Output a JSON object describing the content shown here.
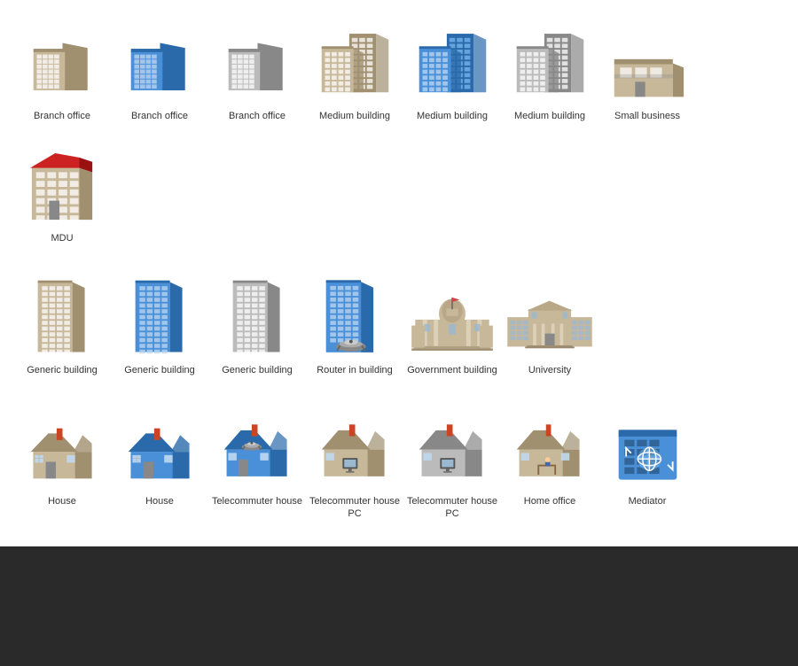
{
  "icons": [
    {
      "id": "branch-office-beige",
      "label": "Branch office",
      "type": "branch-beige"
    },
    {
      "id": "branch-office-blue",
      "label": "Branch office",
      "type": "branch-blue"
    },
    {
      "id": "branch-office-gray",
      "label": "Branch office",
      "type": "branch-gray"
    },
    {
      "id": "medium-building-beige",
      "label": "Medium building",
      "type": "medium-beige"
    },
    {
      "id": "medium-building-blue",
      "label": "Medium building",
      "type": "medium-blue"
    },
    {
      "id": "medium-building-gray",
      "label": "Medium building",
      "type": "medium-gray"
    },
    {
      "id": "small-business",
      "label": "Small business",
      "type": "small-business"
    },
    {
      "id": "mdu",
      "label": "MDU",
      "type": "mdu"
    },
    {
      "id": "generic-building-beige",
      "label": "Generic building",
      "type": "generic-beige"
    },
    {
      "id": "generic-building-blue",
      "label": "Generic building",
      "type": "generic-blue"
    },
    {
      "id": "generic-building-gray",
      "label": "Generic building",
      "type": "generic-gray"
    },
    {
      "id": "router-in-building",
      "label": "Router in building",
      "type": "router-building"
    },
    {
      "id": "government-building",
      "label": "Government building",
      "type": "government"
    },
    {
      "id": "university",
      "label": "University",
      "type": "university"
    },
    {
      "id": "house-beige",
      "label": "House",
      "type": "house-beige"
    },
    {
      "id": "house-blue",
      "label": "House",
      "type": "house-blue"
    },
    {
      "id": "telecommuter-house",
      "label": "Telecommuter house",
      "type": "telecommuter-house"
    },
    {
      "id": "telecommuter-house-pc",
      "label": "Telecommuter house PC",
      "type": "telecommuter-house-pc"
    },
    {
      "id": "telecommuter-house-pc-gray",
      "label": "Telecommuter house PC",
      "type": "telecommuter-house-pc-gray"
    },
    {
      "id": "home-office",
      "label": "Home office",
      "type": "home-office"
    },
    {
      "id": "mediator",
      "label": "Mediator",
      "type": "mediator"
    }
  ]
}
